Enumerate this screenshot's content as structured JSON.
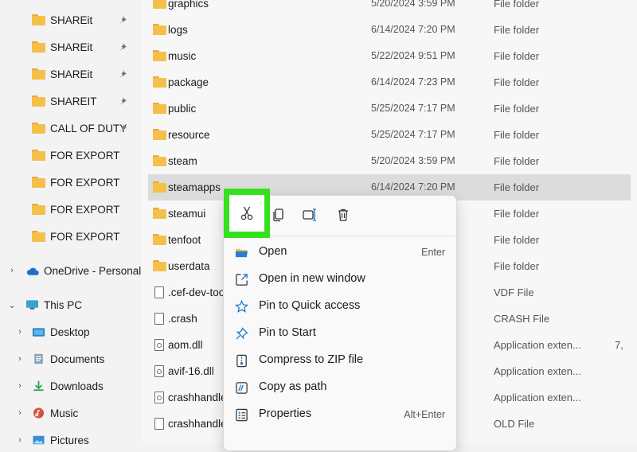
{
  "sidebar": {
    "pinned": [
      {
        "label": "SHAREit"
      },
      {
        "label": "SHAREit"
      },
      {
        "label": "SHAREit"
      },
      {
        "label": "SHAREIT"
      },
      {
        "label": "CALL OF DUTY"
      },
      {
        "label": "FOR EXPORT"
      },
      {
        "label": "FOR EXPORT"
      },
      {
        "label": "FOR EXPORT"
      },
      {
        "label": "FOR EXPORT"
      }
    ],
    "onedrive": "OneDrive - Personal",
    "thispc": "This PC",
    "pc_items": [
      {
        "label": "Desktop",
        "icon": "desktop-icon"
      },
      {
        "label": "Documents",
        "icon": "documents-icon"
      },
      {
        "label": "Downloads",
        "icon": "downloads-icon"
      },
      {
        "label": "Music",
        "icon": "music-icon"
      },
      {
        "label": "Pictures",
        "icon": "pictures-icon"
      }
    ]
  },
  "files": [
    {
      "name": "graphics",
      "date": "5/20/2024 3:59 PM",
      "type": "File folder",
      "size": "",
      "icon": "folder"
    },
    {
      "name": "logs",
      "date": "6/14/2024 7:20 PM",
      "type": "File folder",
      "size": "",
      "icon": "folder"
    },
    {
      "name": "music",
      "date": "5/22/2024 9:51 PM",
      "type": "File folder",
      "size": "",
      "icon": "folder"
    },
    {
      "name": "package",
      "date": "6/14/2024 7:23 PM",
      "type": "File folder",
      "size": "",
      "icon": "folder"
    },
    {
      "name": "public",
      "date": "5/25/2024 7:17 PM",
      "type": "File folder",
      "size": "",
      "icon": "folder"
    },
    {
      "name": "resource",
      "date": "5/25/2024 7:17 PM",
      "type": "File folder",
      "size": "",
      "icon": "folder"
    },
    {
      "name": "steam",
      "date": "5/20/2024 3:59 PM",
      "type": "File folder",
      "size": "",
      "icon": "folder"
    },
    {
      "name": "steamapps",
      "date": "6/14/2024 7:20 PM",
      "type": "File folder",
      "size": "",
      "icon": "folder",
      "selected": true
    },
    {
      "name": "steamui",
      "date": "",
      "type": "File folder",
      "size": "",
      "icon": "folder"
    },
    {
      "name": "tenfoot",
      "date": "",
      "type": "File folder",
      "size": "",
      "icon": "folder"
    },
    {
      "name": "userdata",
      "date": "",
      "type": "File folder",
      "size": "",
      "icon": "folder"
    },
    {
      "name": ".cef-dev-too",
      "date": "",
      "type": "VDF File",
      "size": "",
      "icon": "file"
    },
    {
      "name": ".crash",
      "date": "",
      "type": "CRASH File",
      "size": "",
      "icon": "file"
    },
    {
      "name": "aom.dll",
      "date": "",
      "type": "Application exten...",
      "size": "7,",
      "icon": "dll"
    },
    {
      "name": "avif-16.dll",
      "date": "",
      "type": "Application exten...",
      "size": "",
      "icon": "dll"
    },
    {
      "name": "crashhandle",
      "date": "",
      "type": "Application exten...",
      "size": "",
      "icon": "dll"
    },
    {
      "name": "crashhandle",
      "date": "",
      "type": "OLD File",
      "size": "",
      "icon": "file"
    }
  ],
  "context_menu": {
    "toolbar": [
      {
        "name": "cut-icon",
        "tooltip": ""
      },
      {
        "name": "copy-icon",
        "tooltip": ""
      },
      {
        "name": "rename-icon",
        "tooltip": ""
      },
      {
        "name": "delete-icon",
        "tooltip": ""
      }
    ],
    "items": [
      {
        "label": "Open",
        "shortcut": "Enter",
        "icon": "open-folder-icon"
      },
      {
        "label": "Open in new window",
        "shortcut": "",
        "icon": "open-new-window-icon"
      },
      {
        "label": "Pin to Quick access",
        "shortcut": "",
        "icon": "star-icon"
      },
      {
        "label": "Pin to Start",
        "shortcut": "",
        "icon": "pin-icon"
      },
      {
        "label": "Compress to ZIP file",
        "shortcut": "",
        "icon": "zip-icon"
      },
      {
        "label": "Copy as path",
        "shortcut": "",
        "icon": "copy-path-icon"
      },
      {
        "label": "Properties",
        "shortcut": "Alt+Enter",
        "icon": "properties-icon"
      }
    ]
  },
  "colors": {
    "highlight": "#35e01e",
    "folder": "#f5c04a",
    "selection": "#dcdcdc",
    "accent": "#1a73c7"
  }
}
